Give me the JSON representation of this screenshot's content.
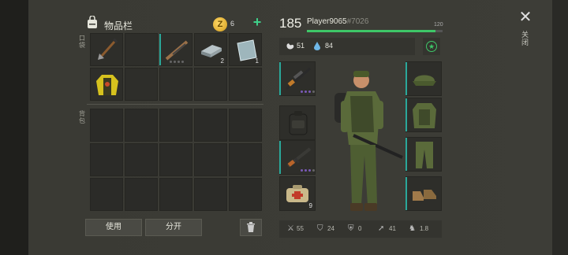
{
  "inventory": {
    "title": "物品栏",
    "coin_symbol": "Z",
    "coins": "6",
    "add": "+",
    "pockets_label": "口袋",
    "backpack_label": "背包",
    "pocket_items": [
      {
        "icon": "shovel-icon",
        "qty": ""
      },
      {
        "icon": "empty",
        "qty": ""
      },
      {
        "icon": "rifle-icon",
        "qty": ""
      },
      {
        "icon": "iron-bar-icon",
        "qty": "2"
      },
      {
        "icon": "glass-sheet-icon",
        "qty": "1"
      },
      {
        "icon": "jacket-icon",
        "qty": ""
      }
    ]
  },
  "actions": {
    "use": "使用",
    "split": "分开"
  },
  "player": {
    "level": "185",
    "name": "Player9065",
    "tag": "#7026",
    "max_level": "120",
    "xp_fraction": 0.95,
    "hunger": "51",
    "thirst": "84"
  },
  "equipment": {
    "left_slots": [
      {
        "icon": "sniper-rifle-icon",
        "qty": ""
      },
      {
        "icon": "backpack-icon",
        "qty": ""
      },
      {
        "icon": "assault-rifle-icon",
        "qty": ""
      },
      {
        "icon": "medkit-icon",
        "qty": "9"
      }
    ],
    "right_slots": [
      "cap-icon",
      "vest-icon",
      "pants-icon",
      "boots-icon"
    ]
  },
  "bottom_stats": {
    "attack": "55",
    "defense": "24",
    "armor": "0",
    "speed": "41",
    "stealth": "1.8"
  },
  "close": {
    "symbol": "✕",
    "label": "关闭"
  },
  "colors": {
    "accent_green": "#3ec768",
    "accent_teal": "#2aa89a",
    "coin": "#e0ad2a"
  }
}
